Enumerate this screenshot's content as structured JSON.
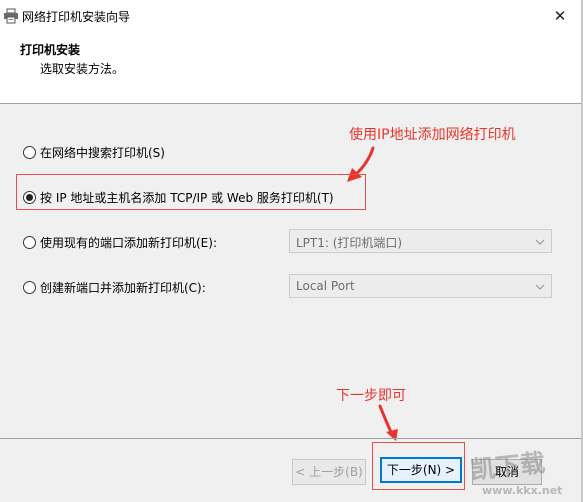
{
  "window": {
    "title": "网络打印机安装向导",
    "close_glyph": "✕"
  },
  "header": {
    "title": "打印机安装",
    "subtitle": "选取安装方法。"
  },
  "options": [
    {
      "label": "在网络中搜索打印机(S)",
      "checked": false
    },
    {
      "label": "按 IP 地址或主机名添加 TCP/IP 或 Web 服务打印机(T)",
      "checked": true
    },
    {
      "label": "使用现有的端口添加新打印机(E):",
      "checked": false
    },
    {
      "label": "创建新端口并添加新打印机(C):",
      "checked": false
    }
  ],
  "dropdowns": {
    "existing_port": {
      "value": "LPT1: (打印机端口)",
      "enabled": false
    },
    "new_port": {
      "value": "Local Port",
      "enabled": false
    }
  },
  "annotations": {
    "top": "使用IP地址添加网络打印机",
    "bottom": "下一步即可",
    "color": "#e8352c"
  },
  "buttons": {
    "back": "< 上一步(B)",
    "next": "下一步(N) >",
    "cancel": "取消"
  },
  "watermark": {
    "line1": "凯下载",
    "line2": "www.kkx.net"
  }
}
